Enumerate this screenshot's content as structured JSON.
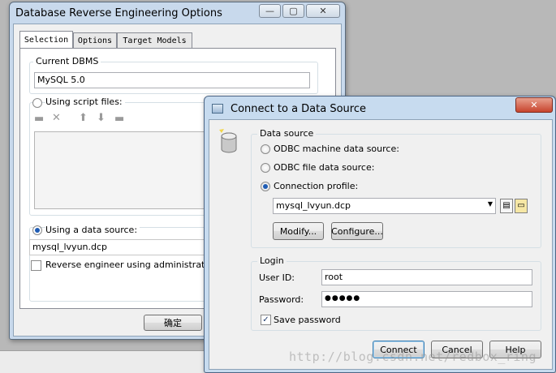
{
  "back_window": {
    "title": "Database Reverse Engineering Options",
    "tabs": [
      "Selection",
      "Options",
      "Target Models"
    ],
    "current_dbms_label": "Current DBMS",
    "current_dbms_value": "MySQL 5.0",
    "script_files_label": "Using script files:",
    "data_source_label": "Using a data source:",
    "data_source_value": "mysql_lvyun.dcp",
    "admin_checkbox_label": "Reverse engineer using administrator's p",
    "ok_button": "确定"
  },
  "dialog": {
    "title": "Connect to a Data Source",
    "data_source_group": "Data source",
    "odbc_machine": "ODBC machine data source:",
    "odbc_file": "ODBC file data source:",
    "connection_profile": "Connection profile:",
    "profile_value": "mysql_lvyun.dcp",
    "modify_button": "Modify...",
    "configure_button": "Configure...",
    "login_group": "Login",
    "user_id_label": "User ID:",
    "user_id_value": "root",
    "password_label": "Password:",
    "password_mask": "●●●●●",
    "save_password_label": "Save password",
    "connect_button": "Connect",
    "cancel_button": "Cancel",
    "help_button": "Help"
  },
  "watermark": "http://blog.csdn.net/redbox_ring"
}
